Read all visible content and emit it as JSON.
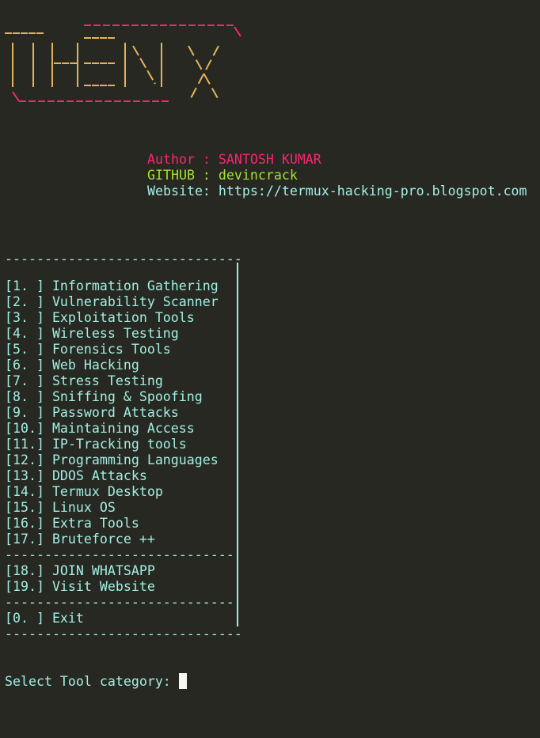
{
  "banner": {
    "lines": [
      "          _________________",
      "______   ____            \\",
      " |    |          \\     \\ /",
      " |    |----|     \\   \\/",
      " |    |          |\\  /\\",
      " |    |    ____  | \\|  / \\",
      "\\_________________  /   \\"
    ]
  },
  "info": {
    "author": "Author : SANTOSH KUMAR",
    "github": "GITHUB : devincrack",
    "website": "Website: https://termux-hacking-pro.blogspot.com"
  },
  "menu": {
    "top_separator": "------------------------------",
    "items": [
      "[1. ] Information Gathering",
      "[2. ] Vulnerability Scanner",
      "[3. ] Exploitation Tools",
      "[4. ] Wireless Testing",
      "[5. ] Forensics Tools",
      "[6. ] Web Hacking",
      "[7. ] Stress Testing",
      "[8. ] Sniffing & Spoofing",
      "[9. ] Password Attacks",
      "[10.] Maintaining Access",
      "[11.] IP-Tracking tools",
      "[12.] Programming Languages",
      "[13.] DDOS Attacks",
      "[14.] Termux Desktop",
      "[15.] Linux OS",
      "[16.] Extra Tools",
      "[17.] Bruteforce ++"
    ],
    "separator": "-----------------------------",
    "extra_items": [
      "[18.] JOIN WHATSAPP",
      "[19.] Visit Website"
    ],
    "exit_item": "[0. ] Exit",
    "bottom_separator": "------------------------------"
  },
  "prompt": {
    "text": "Select Tool category: "
  }
}
